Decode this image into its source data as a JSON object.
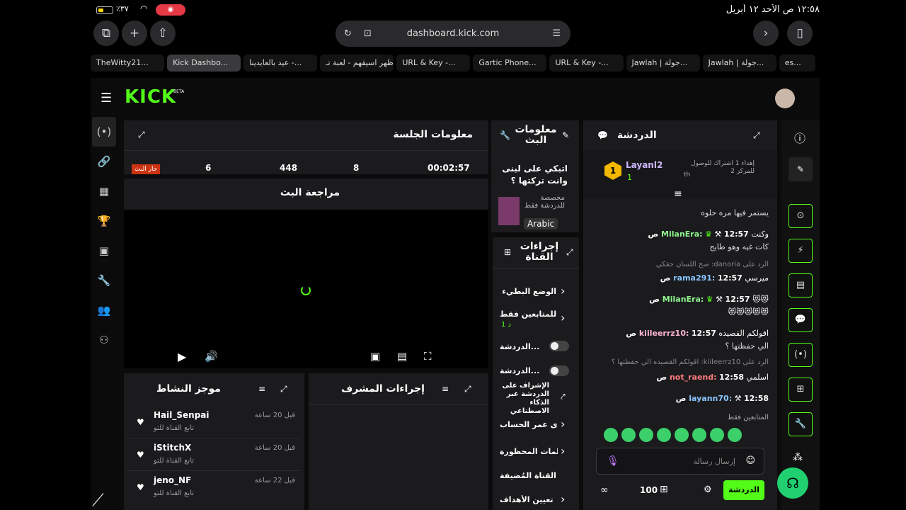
{
  "status": {
    "time": "١٢:٥٨ ص  الأحد ١٢ أبريل",
    "battery": "٪٣٧"
  },
  "browser": {
    "url": "dashboard.kick.com",
    "tabs": [
      "TheWitty21...",
      "Kick Dashbo...",
      "عيد بالعايدينا -...",
      "أظهر اسيقهم - لعبة تـ...",
      "URL & Key -...",
      "Gartic Phone...",
      "URL & Key -...",
      "Jawlah | جولة...",
      "Jawlah | جولة...",
      "es..."
    ]
  },
  "header": {
    "logo": "KICK",
    "beta": "BETA"
  },
  "session": {
    "title": "معلومات الجلسة",
    "live": "جار البث",
    "viewers": "6",
    "followers": "448",
    "subs": "8",
    "duration": "00:02:57"
  },
  "preview": {
    "title": "مراجعة البث"
  },
  "streaminfo": {
    "title": "معلومات البث",
    "stream_title": "اتبكي على لبنى وانت تركتها ؟",
    "category": "مخصصة للدردشة فقط",
    "language": "Arabic"
  },
  "actions": {
    "title": "إجراءات القناة",
    "items": [
      "الوضع البطيء",
      "ة للمتابعين فقط",
      "الدردشة...",
      "الدردشة...",
      "الإشراف على الدردشة عبر الذكاء الاصطناعي",
      "ى عمر الحساب",
      "كلمات المحظورة",
      "القناة المُضيفة",
      "تعيين الأهداف"
    ],
    "followers_sub": "د 1"
  },
  "activity": {
    "title": "موجز النشاط",
    "items": [
      {
        "name": "Hail_Senpai",
        "desc": "تابع القناة للتو",
        "time": "قبل 20 ساعة"
      },
      {
        "name": "iStitchX",
        "desc": "تابع القناة للتو",
        "time": "قبل 20 ساعة"
      },
      {
        "name": "jeno_NF",
        "desc": "تابع القناة للتو",
        "time": "قبل 22 ساعة"
      }
    ]
  },
  "mod": {
    "title": "إجراءات المشرف"
  },
  "chat": {
    "title": "الدردشة",
    "gifter": "Layanl2",
    "gift_count": "1",
    "rank": "1",
    "gift_text": "إهداء 1 اشتراك للوصول للمركز 2",
    "gift_th": "th",
    "messages": [
      {
        "meta": "",
        "name": "",
        "text": "يستمر فيها مره حلوه"
      },
      {
        "meta": "12:57 ص",
        "name": "MilanEra:",
        "text": "وكنت"
      },
      {
        "meta": "",
        "name": "",
        "text": "كات غيه وهو طايح"
      },
      {
        "meta": "الرد على danoria: صح اللسان حقكي",
        "name": "",
        "text": ""
      },
      {
        "meta": "12:57 ص",
        "name": "rama291:",
        "text": "ميرسي"
      },
      {
        "meta": "12:57 ص",
        "name": "MilanEra:",
        "text": "😻😻"
      },
      {
        "meta": "",
        "name": "",
        "text": "😻😻😻😻😻"
      },
      {
        "meta": "12:57 ص",
        "name": "kiileerrz10:",
        "text": "اقولكم القصيده"
      },
      {
        "meta": "",
        "name": "",
        "text": "الي حفظتها ؟"
      },
      {
        "meta": "الرد على kiileerrz10: اقولكم القصيده الي حفظتها ؟",
        "name": "",
        "text": ""
      },
      {
        "meta": "12:58 ص",
        "name": "not_raend:",
        "text": "اسلمي"
      },
      {
        "meta": "12:58 ص",
        "name": "layann70:",
        "text": ""
      }
    ],
    "followers_only": "المتابعين فقط",
    "placeholder": "إرسال رسالة",
    "points": "100",
    "send": "الدردشة"
  },
  "colors": {
    "accent": "#53fc18",
    "live": "#d11"
  }
}
